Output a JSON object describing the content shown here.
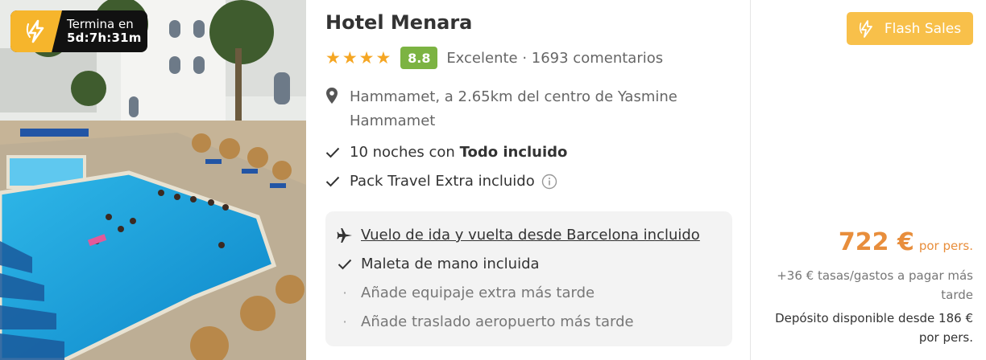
{
  "timer": {
    "label": "Termina en",
    "countdown": "5d:7h:31m",
    "icon": "flash-icon"
  },
  "hotel": {
    "name": "Hotel Menara",
    "stars": 4,
    "score": "8.8",
    "rating_text": "Excelente · 1693 comentarios",
    "location": "Hammamet, a 2.65km del centro de Yasmine Hammamet"
  },
  "features": {
    "nights_prefix": "10 noches con ",
    "nights_bold": "Todo incluido",
    "pack": "Pack Travel Extra incluido"
  },
  "extras": {
    "flight": "Vuelo de ida y vuelta desde Barcelona incluido",
    "baggage": "Maleta de mano incluida",
    "extra_baggage": "Añade equipaje extra más tarde",
    "transfer": "Añade traslado aeropuerto más tarde"
  },
  "offer": {
    "badge_label": "Flash Sales",
    "price": "722 €",
    "per_person": "por pers.",
    "taxes": "+36 € tasas/gastos a pagar más tarde",
    "deposit": "Depósito disponible desde 186 € por pers."
  },
  "colors": {
    "accent_orange": "#e88e3c",
    "flash_yellow": "#f8c04a",
    "score_green": "#7cb342",
    "star_gold": "#f5a623"
  }
}
